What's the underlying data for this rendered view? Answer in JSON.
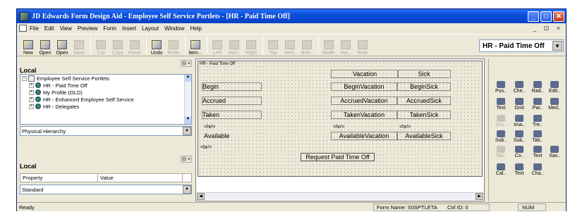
{
  "window": {
    "title": "JD Edwards Form Design Aid - Employee Self Service Portlets - [HR - Paid Time Off]",
    "minimize": "_",
    "maximize": "□",
    "close": "✕"
  },
  "menu": {
    "items": [
      "File",
      "Edit",
      "View",
      "Preview",
      "Form",
      "Insert",
      "Layout",
      "Window",
      "Help"
    ],
    "mdi_controls": "_ ⊡ ×"
  },
  "toolbar": {
    "buttons": [
      {
        "label": "New",
        "enabled": true,
        "icon": "new-icon"
      },
      {
        "label": "Open",
        "enabled": true,
        "icon": "open-icon"
      },
      {
        "label": "Open",
        "enabled": true,
        "icon": "open-icon"
      },
      {
        "label": "Save",
        "enabled": false,
        "icon": "save-icon"
      },
      {
        "label": "Cut",
        "enabled": false,
        "icon": "cut-icon"
      },
      {
        "label": "Copy",
        "enabled": false,
        "icon": "copy-icon"
      },
      {
        "label": "Paste",
        "enabled": false,
        "icon": "paste-icon"
      },
      {
        "label": "Undo",
        "enabled": true,
        "icon": "undo-icon"
      },
      {
        "label": "Redo",
        "enabled": false,
        "icon": "redo-icon"
      },
      {
        "label": "Item...",
        "enabled": true,
        "icon": "item-icon"
      },
      {
        "label": "Left",
        "enabled": false,
        "icon": "align-left-icon"
      },
      {
        "label": "Hori..",
        "enabled": false,
        "icon": "align-horizontal-icon"
      },
      {
        "label": "Right",
        "enabled": false,
        "icon": "align-right-icon"
      },
      {
        "label": "Top",
        "enabled": false,
        "icon": "align-top-icon"
      },
      {
        "label": "Verti..",
        "enabled": false,
        "icon": "align-vertical-icon"
      },
      {
        "label": "Bott..",
        "enabled": false,
        "icon": "align-bottom-icon"
      },
      {
        "label": "Width",
        "enabled": false,
        "icon": "same-width-icon"
      },
      {
        "label": "Hei..",
        "enabled": false,
        "icon": "same-height-icon"
      },
      {
        "label": "Both",
        "enabled": false,
        "icon": "same-size-icon"
      }
    ],
    "form_dropdown": "HR - Paid Time Off"
  },
  "left_top": {
    "title": "Local",
    "tree": [
      {
        "label": "Employee Self Service Portlets",
        "level": 0,
        "expander": "⊟",
        "root": true
      },
      {
        "label": "HR - Paid Time Off",
        "level": 1,
        "expander": "⊞"
      },
      {
        "label": "My Profile (OLD)",
        "level": 1,
        "expander": "⊞"
      },
      {
        "label": "HR - Enhanced Employee Self Service",
        "level": 1,
        "expander": "⊞"
      },
      {
        "label": "HR - Delegates",
        "level": 1,
        "expander": "⊞"
      }
    ],
    "view_select": "Physical Hierarchy"
  },
  "left_bottom": {
    "title": "Local",
    "columns": [
      "Property",
      "Value"
    ],
    "select": "Standard"
  },
  "form": {
    "title": "HR - Paid Time Off",
    "controls": [
      {
        "text": "Vacation",
        "kind": "header"
      },
      {
        "text": "Sick",
        "kind": "header"
      },
      {
        "text": "Begin",
        "kind": "field"
      },
      {
        "text": "BeginVacation",
        "kind": "field"
      },
      {
        "text": "BeginSick",
        "kind": "field"
      },
      {
        "text": "Accrued",
        "kind": "field"
      },
      {
        "text": "AccruedVacation",
        "kind": "field"
      },
      {
        "text": "AccruedSick",
        "kind": "field"
      },
      {
        "text": "Taken",
        "kind": "field"
      },
      {
        "text": "TakenVacation",
        "kind": "field"
      },
      {
        "text": "TakenSick",
        "kind": "field"
      },
      {
        "text": "<hr/>",
        "kind": "rule"
      },
      {
        "text": "<hr/>",
        "kind": "rule"
      },
      {
        "text": "<hr/>",
        "kind": "rule"
      },
      {
        "text": "Available",
        "kind": "field"
      },
      {
        "text": "AvailableVacation",
        "kind": "field"
      },
      {
        "text": "AvailableSick",
        "kind": "field"
      },
      {
        "text": "<br/>",
        "kind": "rule"
      },
      {
        "text": "Request Paid Time Off",
        "kind": "button"
      }
    ]
  },
  "palette": {
    "items": [
      {
        "label": "Pus..",
        "enabled": true
      },
      {
        "label": "Che..",
        "enabled": true
      },
      {
        "label": "Rad..",
        "enabled": true
      },
      {
        "label": "Edit..",
        "enabled": true
      },
      {
        "label": "Text",
        "enabled": true
      },
      {
        "label": "Grid",
        "enabled": true
      },
      {
        "label": "Par..",
        "enabled": true
      },
      {
        "label": "Med..",
        "enabled": true
      },
      {
        "label": "Gro..",
        "enabled": false
      },
      {
        "label": "Ima..",
        "enabled": true
      },
      {
        "label": "Tre..",
        "enabled": true
      },
      {
        "label": "Sub..",
        "enabled": true
      },
      {
        "label": "Sub..",
        "enabled": true
      },
      {
        "label": "Tab..",
        "enabled": true
      },
      {
        "label": "Tab..",
        "enabled": false
      },
      {
        "label": "Co..",
        "enabled": true
      },
      {
        "label": "Text",
        "enabled": true
      },
      {
        "label": "Sav..",
        "enabled": true
      },
      {
        "label": "Cal..",
        "enabled": true
      },
      {
        "label": "Text",
        "enabled": true
      },
      {
        "label": "Cha..",
        "enabled": true
      }
    ]
  },
  "status": {
    "left": "Ready",
    "form_name": "Form Name: S0SPTLETA",
    "ctrl_id": "Ctrl ID:  0",
    "num": "NUM"
  }
}
